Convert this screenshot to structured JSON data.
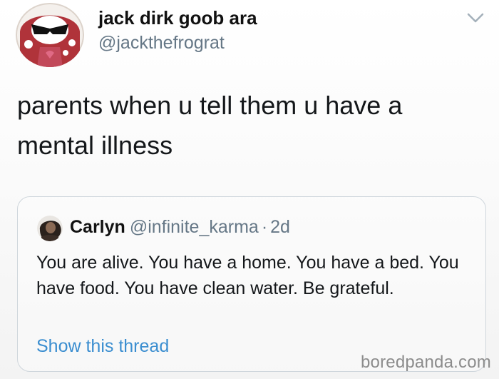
{
  "tweet": {
    "author": {
      "display_name": "jack dirk goob ara",
      "handle": "@jackthefrograt",
      "avatar_icon": "cartoon-avatar-icon"
    },
    "menu_icon": "chevron-down-icon",
    "text": "parents when u tell them u have a mental illness"
  },
  "quote": {
    "author": {
      "display_name": "Carlyn",
      "handle": "@infinite_karma",
      "separator": "·",
      "time": "2d",
      "avatar_icon": "user-avatar-icon"
    },
    "text": "You are alive. You have a home. You have a bed. You have food. You have clean water. Be grateful.",
    "show_thread_label": "Show this thread"
  },
  "watermark": "boredpanda.com",
  "colors": {
    "link": "#3b8ed0",
    "secondary_text": "#657786",
    "border": "#cfd6dc"
  }
}
